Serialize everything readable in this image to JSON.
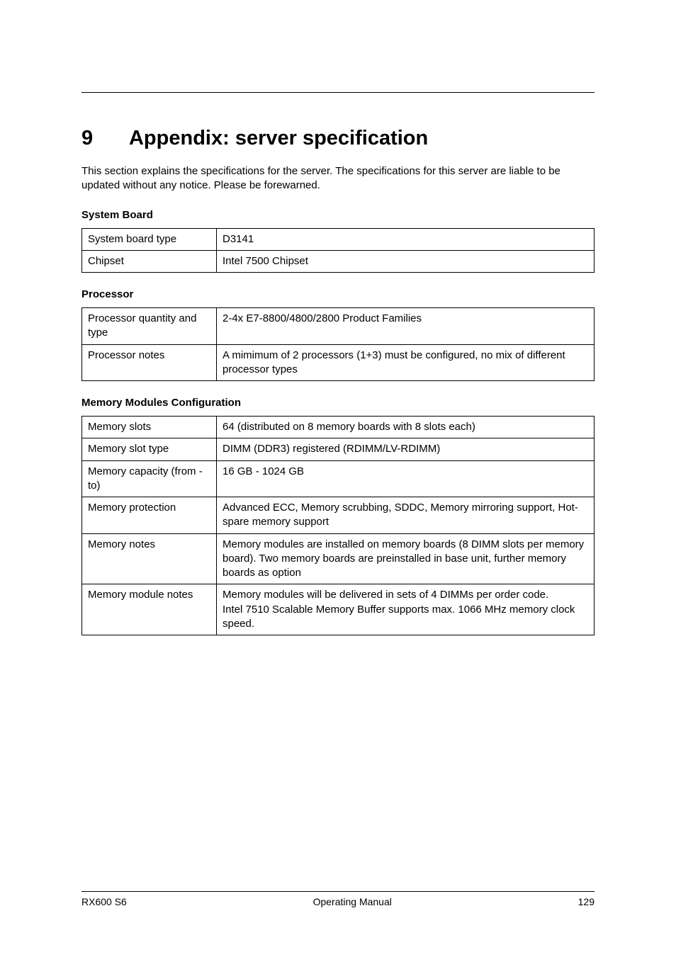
{
  "chapter": {
    "number": "9",
    "title": "Appendix: server specification"
  },
  "intro": "This section explains the specifications for the server. The specifications for this server are liable to be updated without any notice. Please be forewarned.",
  "sections": {
    "system_board": {
      "heading": "System Board",
      "rows": [
        {
          "label": "System board type",
          "value": "D3141"
        },
        {
          "label": "Chipset",
          "value": "Intel 7500 Chipset"
        }
      ]
    },
    "processor": {
      "heading": "Processor",
      "rows": [
        {
          "label": "Processor quantity and type",
          "value": "2-4x E7-8800/4800/2800 Product Families"
        },
        {
          "label": "Processor notes",
          "value": "A mimimum of 2 processors (1+3) must be configured, no mix of different processor types"
        }
      ]
    },
    "memory": {
      "heading": "Memory Modules Configuration",
      "rows": [
        {
          "label": "Memory slots",
          "value": "64 (distributed on 8 memory boards with 8 slots each)"
        },
        {
          "label": "Memory slot type",
          "value": "DIMM (DDR3) registered (RDIMM/LV-RDIMM)"
        },
        {
          "label": "Memory capacity (from - to)",
          "value": "16 GB - 1024 GB"
        },
        {
          "label": "Memory protection",
          "value": "Advanced ECC, Memory scrubbing, SDDC, Memory mirroring support, Hot-spare memory support"
        },
        {
          "label": "Memory notes",
          "value": "Memory modules are installed on memory boards  (8 DIMM slots per memory board). Two memory boards are preinstalled in base unit, further memory boards as option"
        },
        {
          "label": "Memory module notes",
          "value": "Memory modules will be delivered in sets of 4 DIMMs per order code.\nIntel 7510 Scalable Memory Buffer supports max. 1066 MHz memory clock speed."
        }
      ]
    }
  },
  "footer": {
    "left": "RX600 S6",
    "center": "Operating Manual",
    "right": "129"
  }
}
